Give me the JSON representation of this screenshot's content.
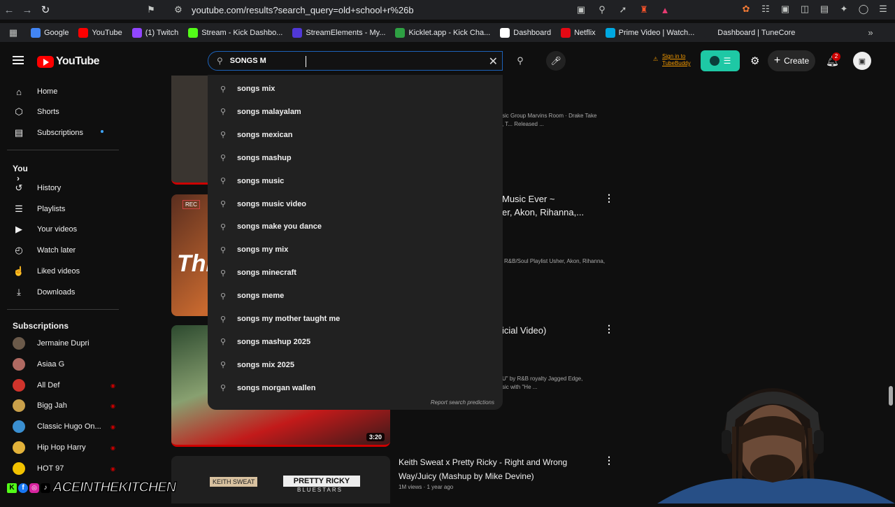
{
  "browser": {
    "url": "youtube.com/results?search_query=old+school+r%26b",
    "bookmarks": [
      {
        "label": "Google",
        "color": "#4285f4"
      },
      {
        "label": "YouTube",
        "color": "#ff0000"
      },
      {
        "label": "(1) Twitch",
        "color": "#9146ff"
      },
      {
        "label": "Stream - Kick Dashbo...",
        "color": "#53fc18"
      },
      {
        "label": "StreamElements - My...",
        "color": "#5038d6"
      },
      {
        "label": "Kicklet.app - Kick Cha...",
        "color": "#2ea043"
      },
      {
        "label": "Dashboard",
        "color": "#ffffff"
      },
      {
        "label": "Netflix",
        "color": "#e50914"
      },
      {
        "label": "Prime Video | Watch...",
        "color": "#00a8e1"
      },
      {
        "label": "Dashboard | TuneCore",
        "color": "#202124"
      }
    ]
  },
  "header": {
    "logo_text": "YouTube",
    "search_value": "SONGS M",
    "tubebuddy_sign_in": "Sign in to",
    "tubebuddy_name": "TubeBuddy",
    "create_label": "Create",
    "notif_count": "2"
  },
  "sidebar": {
    "main": [
      {
        "label": "Home",
        "icon": "home-icon"
      },
      {
        "label": "Shorts",
        "icon": "shorts-icon"
      },
      {
        "label": "Subscriptions",
        "icon": "subscriptions-icon"
      }
    ],
    "you_label": "You",
    "you_items": [
      {
        "label": "History",
        "icon": "history-icon"
      },
      {
        "label": "Playlists",
        "icon": "playlists-icon"
      },
      {
        "label": "Your videos",
        "icon": "your-videos-icon"
      },
      {
        "label": "Watch later",
        "icon": "watch-later-icon"
      },
      {
        "label": "Liked videos",
        "icon": "liked-icon"
      },
      {
        "label": "Downloads",
        "icon": "downloads-icon"
      }
    ],
    "subs_label": "Subscriptions",
    "subs": [
      {
        "label": "Jermaine Dupri",
        "color": "#6b5a4a",
        "live": false
      },
      {
        "label": "Asiaa G",
        "color": "#b06a62",
        "live": false
      },
      {
        "label": "All Def",
        "color": "#d0342c",
        "live": true
      },
      {
        "label": "Bigg Jah",
        "color": "#c9a04a",
        "live": true
      },
      {
        "label": "Classic Hugo On...",
        "color": "#3a8fd1",
        "live": true
      },
      {
        "label": "Hip Hop Harry",
        "color": "#e2b23a",
        "live": true
      },
      {
        "label": "HOT 97",
        "color": "#f2c200",
        "live": true
      }
    ]
  },
  "suggestions": [
    "songs mix",
    "songs malayalam",
    "songs mexican",
    "songs mashup",
    "songs music",
    "songs music video",
    "songs make you dance",
    "songs my mix",
    "songs minecraft",
    "songs meme",
    "songs my mother taught me",
    "songs mashup 2025",
    "songs mix 2025",
    "songs morgan wallen"
  ],
  "report_label": "Report search predictions",
  "results": [
    {
      "title_partial": "",
      "meta": "sic Group Marvins Room · Drake Take\n, T... Released ..."
    },
    {
      "title_partial": "Music Ever ~\ner, Akon, Rihanna,...",
      "meta": "R&B/Soul Playlist Usher, Akon, Rihanna,"
    },
    {
      "title_partial": "icial Video)",
      "meta": "U\" by R&B royalty Jagged Edge,\nsic with \"He ..."
    },
    {
      "title_partial": "Keith Sweat x Pretty Ricky - Right and Wrong\nWay/Juicy (Mashup by Mike Devine)",
      "meta": "1M views · 1 year ago"
    }
  ],
  "thumb_labels": {
    "rec": "REC",
    "thumb2_text": "Thi",
    "duration3": "3:20",
    "pretty_ricky": "PRETTY RICKY",
    "keith": "KEITH SWEAT",
    "bluestars": "BLUESTARS"
  },
  "channel_tag": "ACEINTHEKITCHEN"
}
